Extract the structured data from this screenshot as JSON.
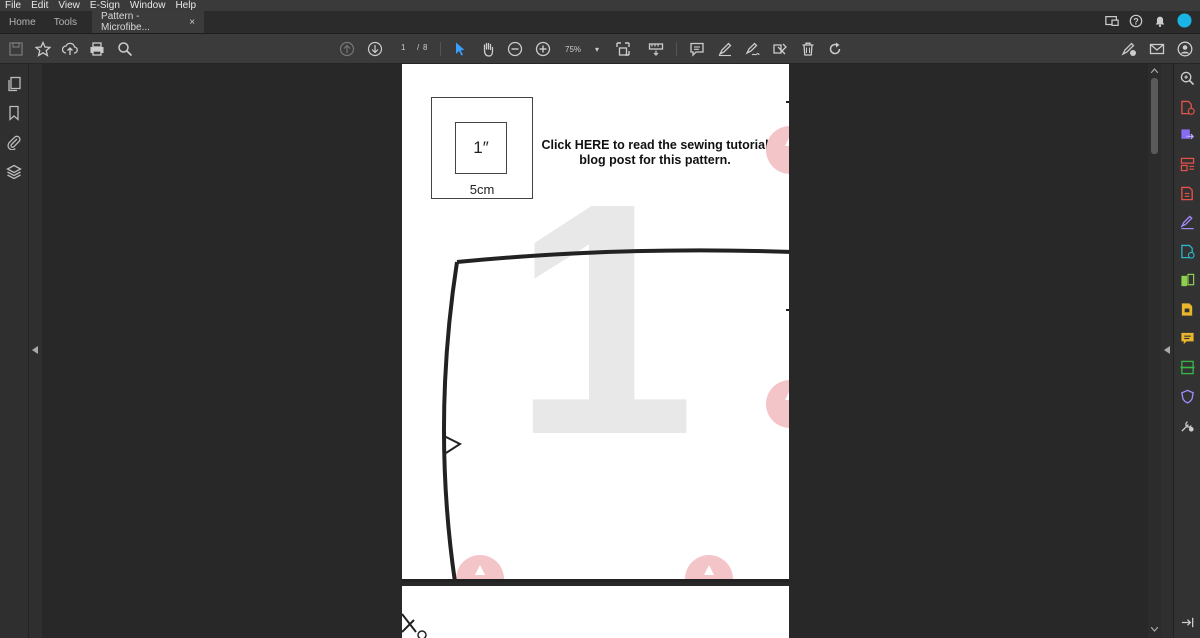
{
  "menu": [
    "File",
    "Edit",
    "View",
    "E-Sign",
    "Window",
    "Help"
  ],
  "tabs": {
    "home": "Home",
    "tools": "Tools",
    "document": "Pattern - Microfibe...",
    "close_glyph": "×"
  },
  "toolbar": {
    "current_page": "1",
    "page_separator": "/",
    "total_pages": "8",
    "zoom_level": "75%"
  },
  "document": {
    "link_text": "Click HERE to read the sewing tutorial blog post for this pattern.",
    "scale_inch": "1″",
    "scale_cm": "5cm",
    "piece_number": "1"
  },
  "colors": {
    "accent": "#1ab3e6",
    "watermark_star": "#f3c4c8",
    "selected_tool": "#3aa0ff"
  },
  "icons": {
    "toolbar": [
      "save-icon",
      "star-icon",
      "upload-icon",
      "print-icon",
      "search-icon",
      "page-up-icon",
      "page-down-icon",
      "select-arrow-icon",
      "hand-icon",
      "zoom-out-icon",
      "zoom-in-icon",
      "fit-page-icon",
      "measure-icon",
      "comment-icon",
      "highlight-icon",
      "sign-icon",
      "redact-icon",
      "delete-icon",
      "rotate-icon",
      "fill-sign-icon",
      "mail-icon",
      "share-user-icon"
    ],
    "left_rail": [
      "pages-icon",
      "bookmark-icon",
      "attachment-icon",
      "layers-icon"
    ],
    "right_rail": [
      "zoom-tool-icon",
      "create-pdf-icon",
      "export-pdf-icon",
      "organize-pages-icon",
      "edit-pdf-icon",
      "fill-sign-tool-icon",
      "protect-icon",
      "compare-icon",
      "prepare-form-icon",
      "comment-tool-icon",
      "scan-icon",
      "shield-icon",
      "more-tools-icon",
      "collapse-panel-icon"
    ]
  }
}
